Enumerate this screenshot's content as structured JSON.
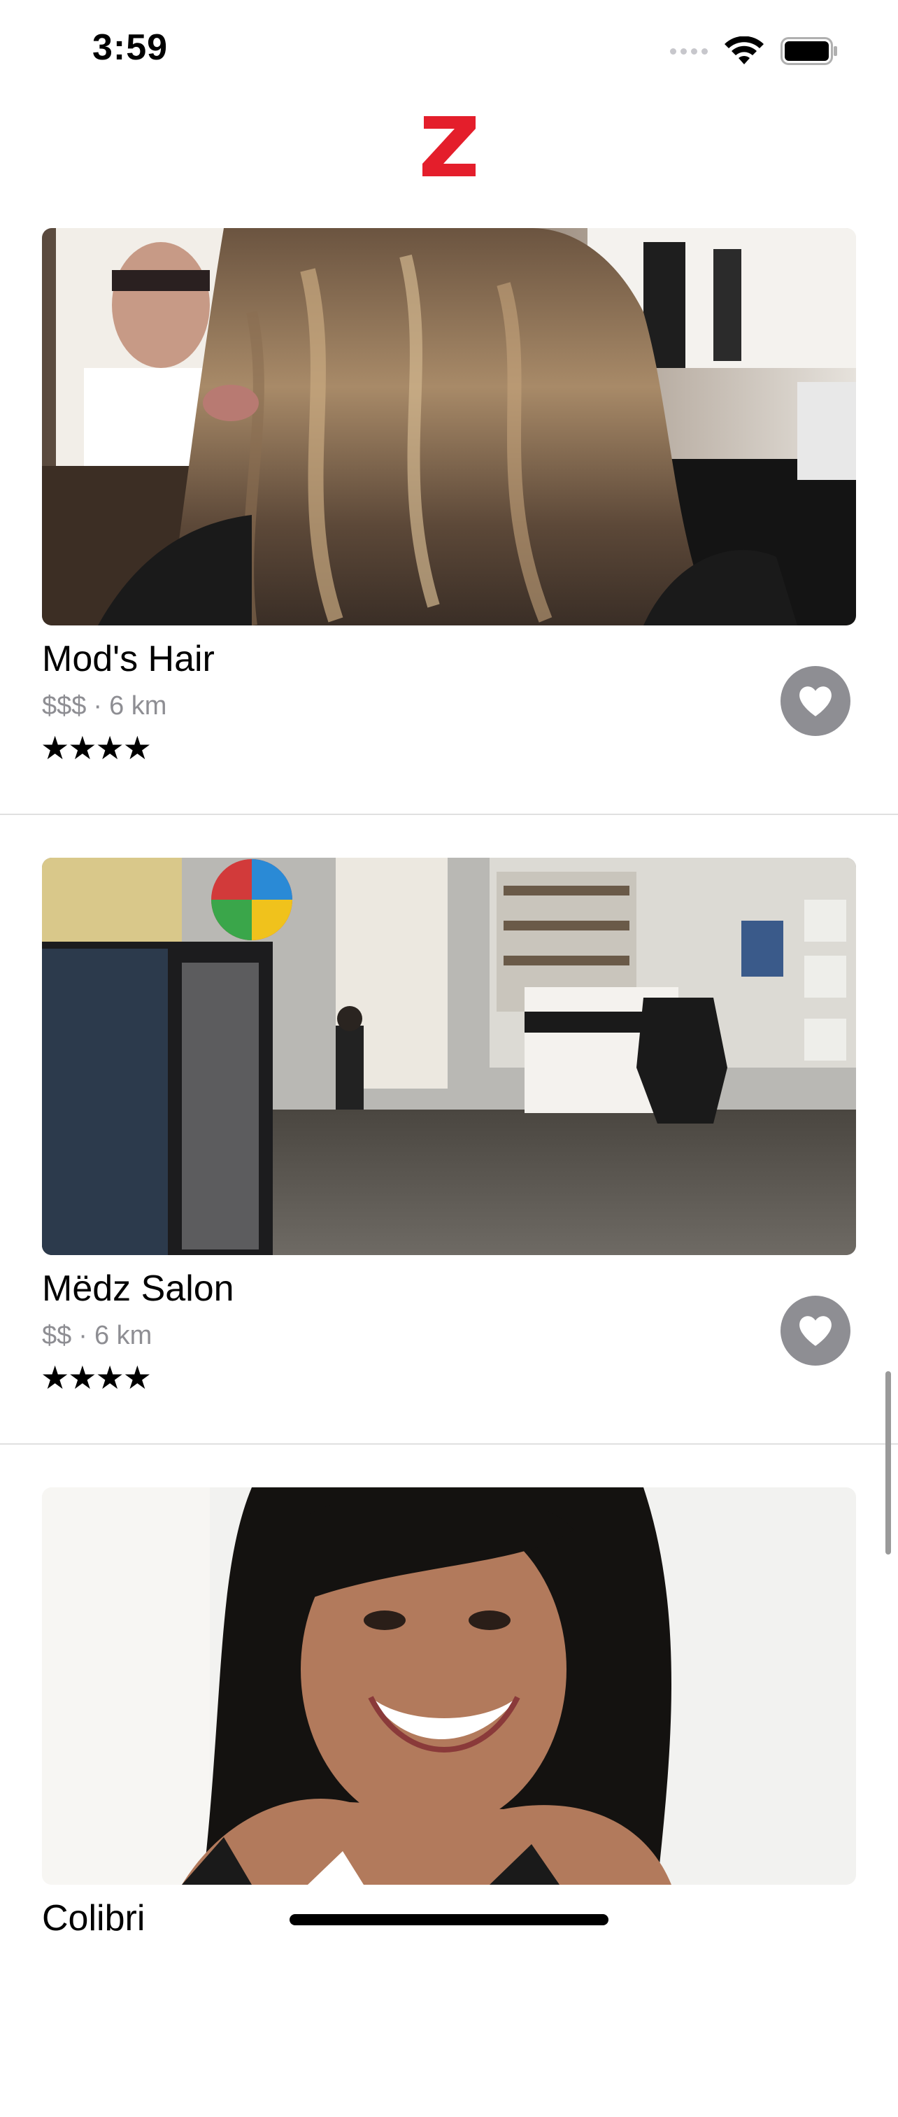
{
  "status_bar": {
    "time": "3:59"
  },
  "colors": {
    "brand": "#e41e2b",
    "favorite_button": "#8e8e93",
    "meta_text": "#8e8e93"
  },
  "header": {
    "logo_icon": "z-logo-icon"
  },
  "salons": [
    {
      "name": "Mod's Hair",
      "price": "$$$",
      "separator": "·",
      "distance": "6 km",
      "stars": "★★★★",
      "rating": 4,
      "photo": "long wavy balayage hair in salon"
    },
    {
      "name": "Mëdz Salon",
      "price": "$$",
      "separator": "·",
      "distance": "6 km",
      "stars": "★★★★",
      "rating": 4,
      "photo": "salon interior with styling chairs"
    },
    {
      "name": "Colibri",
      "photo": "smiling woman with dark wavy hair"
    }
  ]
}
